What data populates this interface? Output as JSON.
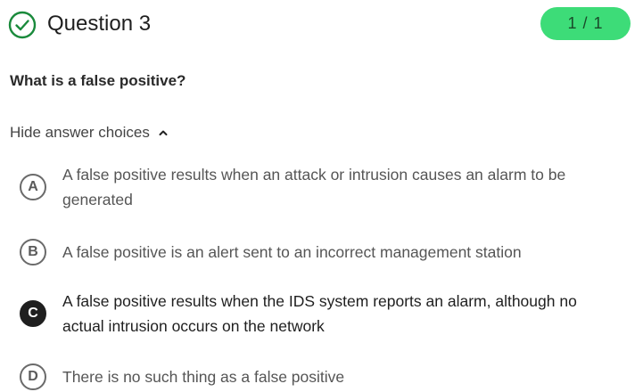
{
  "header": {
    "status_icon": "check-circle-icon",
    "title": "Question 3",
    "score": "1 / 1",
    "score_color": "#3ddc78",
    "status_color": "#1a8a3c"
  },
  "question": {
    "prompt": "What is a false positive?"
  },
  "toggle": {
    "label": "Hide answer choices",
    "icon": "chevron-up-icon"
  },
  "choices": [
    {
      "letter": "A",
      "text": "A false positive results when an attack or intrusion causes an alarm to be generated",
      "selected": false
    },
    {
      "letter": "B",
      "text": "A false positive is an alert sent to an incorrect management station",
      "selected": false
    },
    {
      "letter": "C",
      "text": "A false positive results when the IDS system reports an alarm, although no actual intrusion occurs on the network",
      "selected": true
    },
    {
      "letter": "D",
      "text": "There is no such thing as a false positive",
      "selected": false
    }
  ]
}
